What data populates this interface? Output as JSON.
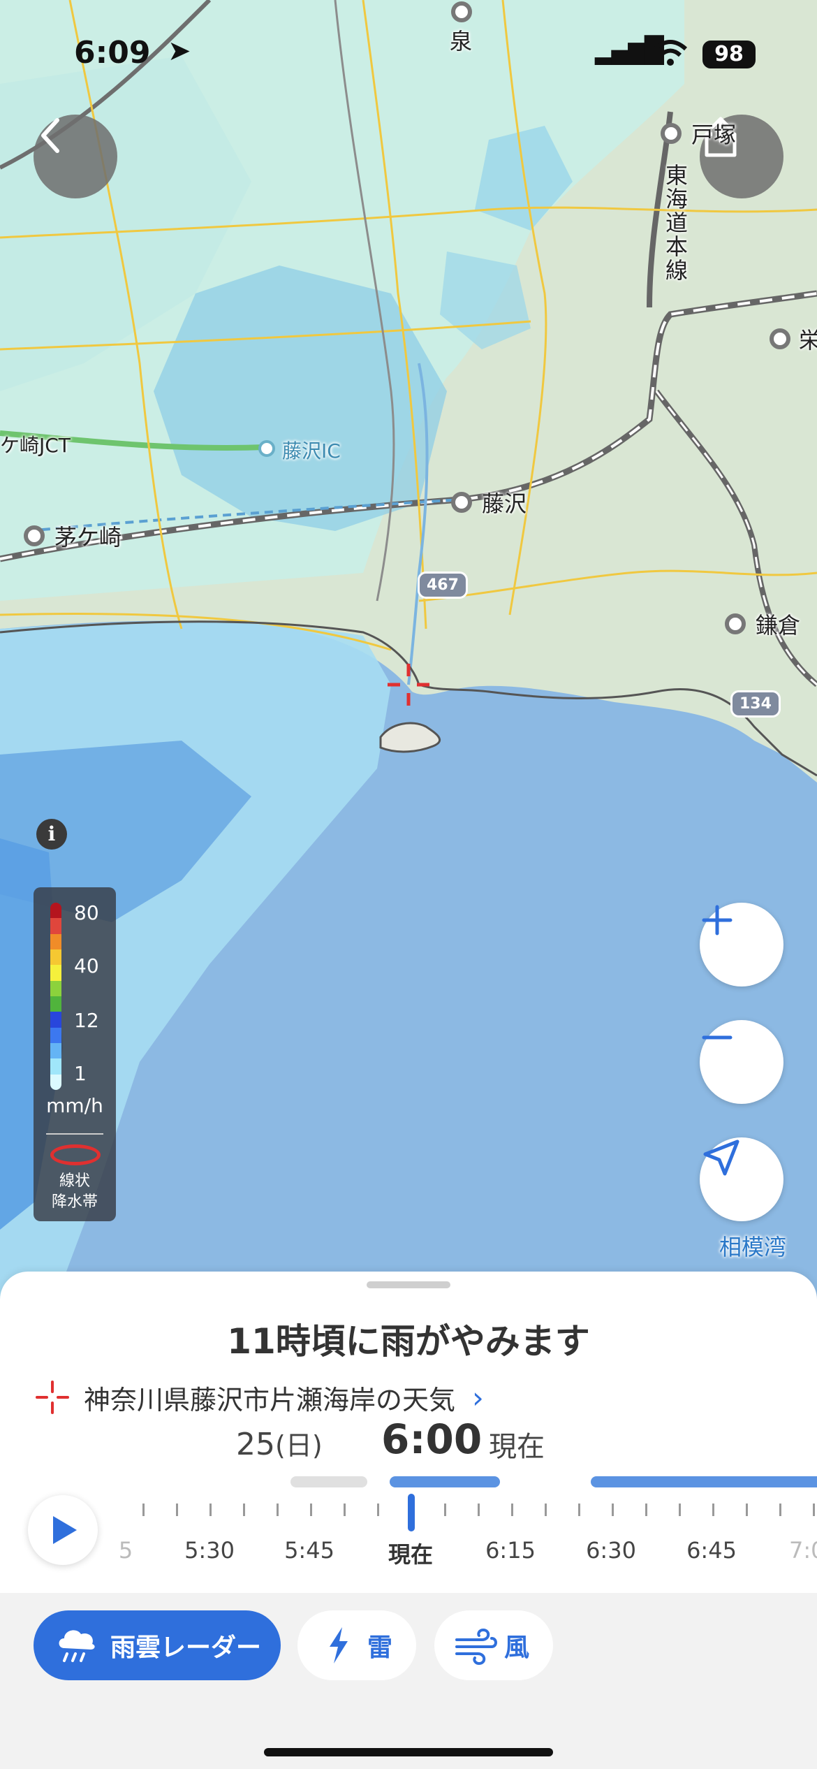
{
  "status_bar": {
    "time": "6:09",
    "battery": "98"
  },
  "map": {
    "labels": {
      "izumi": "泉",
      "totsuka": "戸塚",
      "tokaido_line": "東海道本線",
      "sakae": "栄",
      "chigasaki_jct": "ケ崎JCT",
      "fujisawa_ic": "藤沢IC",
      "fujisawa": "藤沢",
      "chigasaki": "茅ケ崎",
      "kamakura": "鎌倉",
      "sagami_bay": "相模湾",
      "route_467": "467",
      "route_134": "134"
    },
    "buttons": {
      "back": "back-icon",
      "share": "share-icon",
      "zoom_in": "plus-icon",
      "zoom_out": "minus-icon",
      "locate": "navigation-arrow-icon"
    },
    "info": "i"
  },
  "legend": {
    "values": [
      "80",
      "40",
      "12",
      "1"
    ],
    "unit": "mm/h",
    "band_line1": "線状",
    "band_line2": "降水帯",
    "colors": [
      "#b4141e",
      "#e0463c",
      "#f08c28",
      "#f5c832",
      "#f5f03c",
      "#8cd23c",
      "#50b43c",
      "#2846dc",
      "#3c78f0",
      "#64b4f5",
      "#a0e6fa",
      "#dcfaff"
    ]
  },
  "sheet": {
    "headline": "11時頃に雨がやみます",
    "location": "神奈川県藤沢市片瀬海岸の天気",
    "date_day": "25",
    "date_weekday": "(日)",
    "time": "6:00",
    "now_label": "現在",
    "timeline": {
      "labels": [
        {
          "text": "5:30",
          "now": false
        },
        {
          "text": "5:45",
          "now": false
        },
        {
          "text": "現在",
          "now": true
        },
        {
          "text": "6:15",
          "now": false
        },
        {
          "text": "6:30",
          "now": false
        },
        {
          "text": "6:45",
          "now": false
        }
      ],
      "edge_left": "5",
      "edge_right": "7:0"
    }
  },
  "toolbar": {
    "radar": "雨雲レーダー",
    "thunder": "雷",
    "wind": "風"
  },
  "colors": {
    "accent": "#2f6fdc"
  }
}
